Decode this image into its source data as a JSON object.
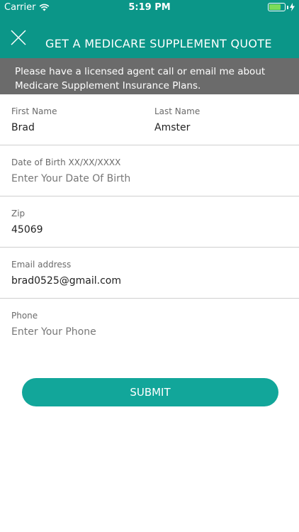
{
  "status_bar": {
    "carrier": "Carrier",
    "time": "5:19 PM"
  },
  "header": {
    "title": "GET A MEDICARE SUPPLEMENT QUOTE",
    "close_icon": "close-icon"
  },
  "notice": "Please have a licensed agent call or email me about Medicare Supplement Insurance Plans.",
  "form": {
    "first_name": {
      "label": "First Name",
      "value": "Brad"
    },
    "last_name": {
      "label": "Last Name",
      "value": "Amster"
    },
    "dob": {
      "label": "Date of Birth XX/XX/XXXX",
      "value": "",
      "placeholder": "Enter Your Date Of Birth"
    },
    "zip": {
      "label": "Zip",
      "value": "45069"
    },
    "email": {
      "label": "Email address",
      "value": "brad0525@gmail.com"
    },
    "phone": {
      "label": "Phone",
      "value": "",
      "placeholder": "Enter Your Phone"
    }
  },
  "submit_label": "SUBMIT",
  "colors": {
    "primary": "#0b9688",
    "button": "#12a69a",
    "notice_bg": "#6b6b6b"
  }
}
